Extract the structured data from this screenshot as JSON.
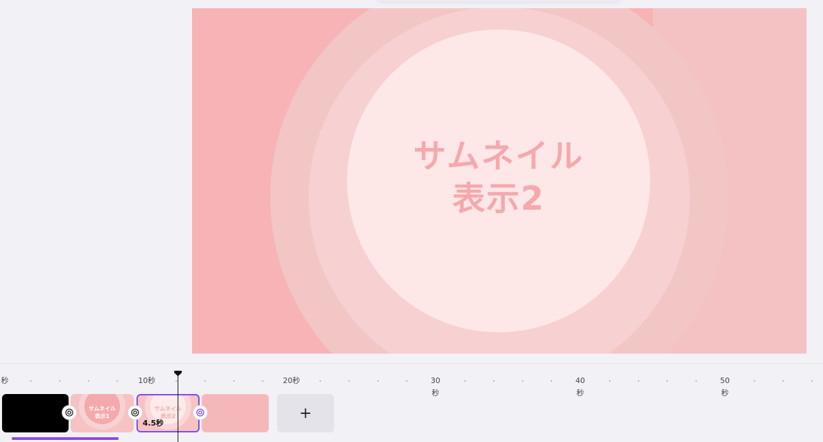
{
  "canvas": {
    "title_line1": "サムネイル",
    "title_line2": "表示2",
    "background_color": "#f7b3b6",
    "accent_color": "#f5a9ad"
  },
  "timeline": {
    "ruler": [
      {
        "line1": "秒",
        "line2": ""
      },
      {
        "line1": "10秒",
        "line2": ""
      },
      {
        "line1": "20秒",
        "line2": ""
      },
      {
        "line1": "30",
        "line2": "秒"
      },
      {
        "line1": "40",
        "line2": "秒"
      },
      {
        "line1": "50",
        "line2": "秒"
      }
    ],
    "playhead_seconds": 12.2,
    "clips": [
      {
        "thumbnail_text": "",
        "color": "#000000"
      },
      {
        "thumbnail_text_line1": "サムネイル",
        "thumbnail_text_line2": "表示1"
      },
      {
        "thumbnail_text_line1": "サムネイル",
        "thumbnail_text_line2": "表示2",
        "duration": "4.5秒",
        "selected": true
      },
      {
        "thumbnail_text": ""
      }
    ],
    "add_button_label": "+",
    "transition_icon": "transition-icon",
    "selection_color": "#7d4be5",
    "progress_color": "#8b4af0"
  }
}
